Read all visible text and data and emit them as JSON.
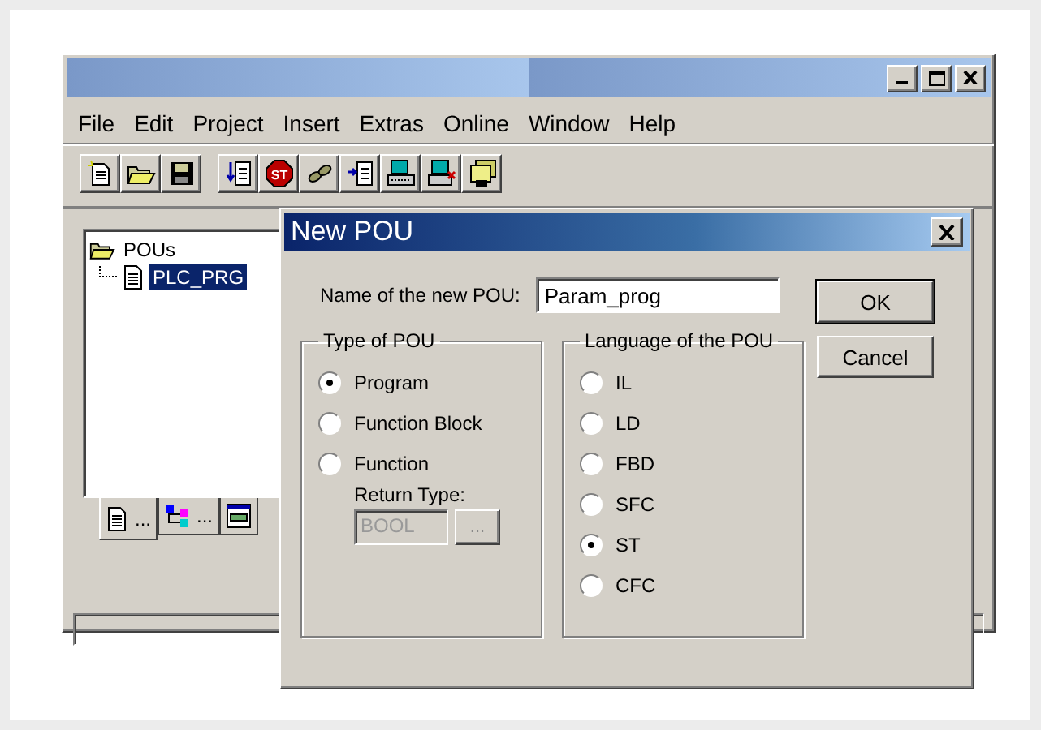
{
  "main_window": {
    "menu": [
      "File",
      "Edit",
      "Project",
      "Insert",
      "Extras",
      "Online",
      "Window",
      "Help"
    ],
    "toolbar": [
      {
        "kind": "new"
      },
      {
        "kind": "open"
      },
      {
        "kind": "save"
      },
      {
        "kind": "separator"
      },
      {
        "kind": "download"
      },
      {
        "kind": "stop",
        "label": "ST"
      },
      {
        "kind": "step"
      },
      {
        "kind": "insert"
      },
      {
        "kind": "computer"
      },
      {
        "kind": "computer-off"
      },
      {
        "kind": "library"
      }
    ],
    "tree": {
      "label": "POUs",
      "expanded": true,
      "children": [
        {
          "label": "PLC_PRG",
          "selected": true
        }
      ]
    },
    "pane_tabs": [
      {
        "kind": "pous",
        "label": "...",
        "selected": true
      },
      {
        "kind": "types",
        "label": "...",
        "selected": false
      },
      {
        "kind": "visual",
        "selected": false
      }
    ]
  },
  "dialog": {
    "title": "New POU",
    "name_label": "Name of the new POU:",
    "name_value": "Param_prog",
    "buttons": [
      "OK",
      "Cancel"
    ],
    "type_group": {
      "title": "Type of POU",
      "options": [
        {
          "label": "Program",
          "selected": true
        },
        {
          "label": "Function Block",
          "selected": false
        },
        {
          "label": "Function",
          "selected": false
        }
      ],
      "return_type": {
        "label": "Return Type:",
        "value": "BOOL",
        "disabled": true,
        "browse": "..."
      }
    },
    "language_group": {
      "title": "Language of the POU",
      "options": [
        {
          "label": "IL",
          "selected": false
        },
        {
          "label": "LD",
          "selected": false
        },
        {
          "label": "FBD",
          "selected": false
        },
        {
          "label": "SFC",
          "selected": false
        },
        {
          "label": "ST",
          "selected": true
        },
        {
          "label": "CFC",
          "selected": false
        }
      ]
    }
  }
}
